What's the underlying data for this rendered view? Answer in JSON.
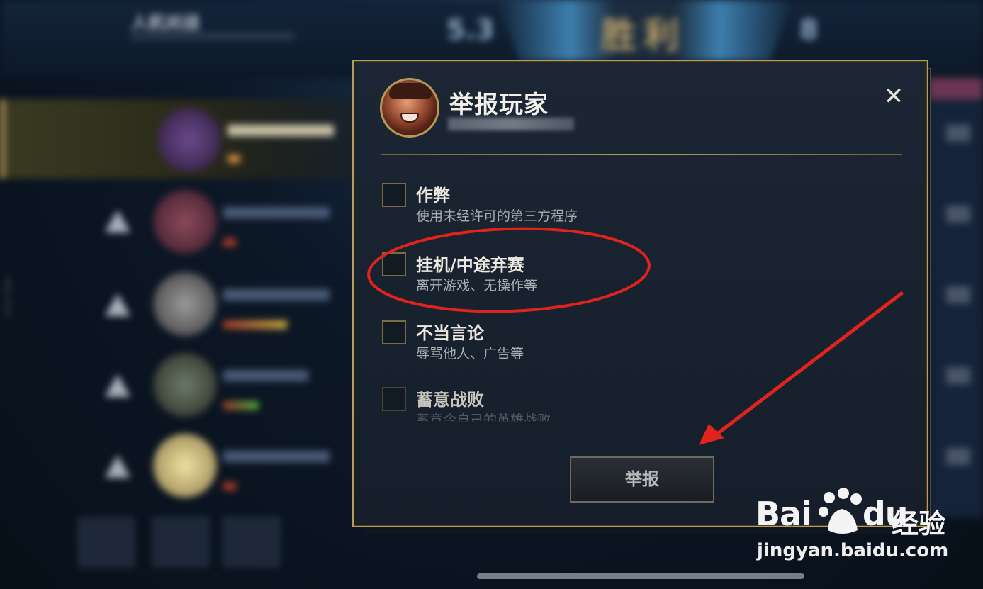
{
  "background": {
    "header_title": "人机对战",
    "score_left": "5.3",
    "result": "胜利",
    "score_right": "8",
    "vertical_text": "1599-1915"
  },
  "modal": {
    "title": "举报玩家",
    "close_icon": "close-icon",
    "options": [
      {
        "title": "作弊",
        "desc": "使用未经许可的第三方程序",
        "checked": false
      },
      {
        "title": "挂机/中途弃赛",
        "desc": "离开游戏、无操作等",
        "checked": false
      },
      {
        "title": "不当言论",
        "desc": "辱骂他人、广告等",
        "checked": false
      },
      {
        "title": "蓄意战败",
        "desc": "蓄意令自己的英雄战败",
        "checked": false
      }
    ],
    "submit_label": "举报"
  },
  "watermark": {
    "logo": "Bai",
    "logo2": "du",
    "cn": "经验",
    "url": "jingyan.baidu.com"
  },
  "colors": {
    "accent_gold": "#b99c5a",
    "annotation_red": "#e0231d"
  }
}
